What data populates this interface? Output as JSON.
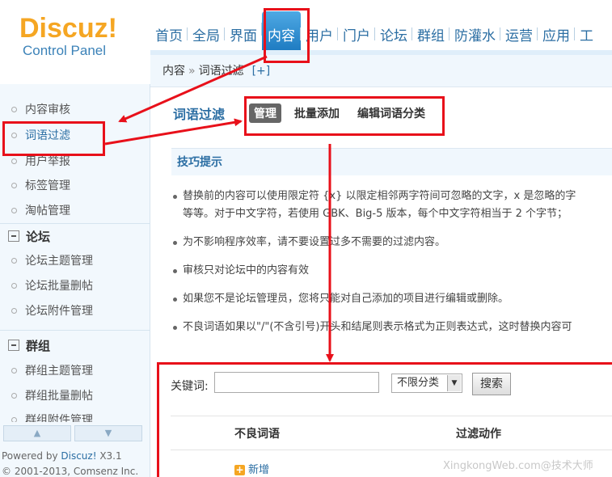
{
  "logo": {
    "main": "Discuz!",
    "sub": "Control Panel"
  },
  "topnav": [
    "首页",
    "全局",
    "界面",
    "内容",
    "用户",
    "门户",
    "论坛",
    "群组",
    "防灌水",
    "运营",
    "应用",
    "工"
  ],
  "breadcrumb": {
    "parent": "内容",
    "sep": "»",
    "current": "词语过滤",
    "expand": "[+]"
  },
  "sidebar": {
    "items": [
      "内容审核",
      "词语过滤",
      "用户举报",
      "标签管理",
      "淘帖管理"
    ],
    "forum_group": "论坛",
    "forum_items": [
      "论坛主题管理",
      "论坛批量删帖",
      "论坛附件管理"
    ],
    "group_group": "群组",
    "group_items": [
      "群组主题管理",
      "群组批量删帖",
      "群组附件管理"
    ],
    "scroll_up": "▲",
    "scroll_down": "▼",
    "powered_prefix": "Powered by ",
    "powered_brand": "Discuz!",
    "powered_version": " X3.1",
    "copyright": "© 2001-2013, Comsenz Inc."
  },
  "main": {
    "title": "词语过滤",
    "subtabs": [
      "管理",
      "批量添加",
      "编辑词语分类"
    ],
    "tips_title": "技巧提示",
    "tips": [
      "替换前的内容可以使用限定符 {x} 以限定相邻两字符间可忽略的文字，x 是忽略的字",
      "等等。对于中文字符，若使用 GBK、Big-5 版本，每个中文字符相当于 2 个字节；",
      "为不影响程序效率，请不要设置过多不需要的过滤内容。",
      "审核只对论坛中的内容有效",
      "如果您不是论坛管理员，您将只能对自己添加的项目进行编辑或删除。",
      "不良词语如果以\"/\"(不含引号)开头和结尾则表示格式为正则表达式，这时替换内容可"
    ]
  },
  "search": {
    "label": "关键词:",
    "input_value": "",
    "select_value": "不限分类",
    "select_arrow": "▼",
    "button": "搜索",
    "col_word": "不良词语",
    "col_action": "过滤动作",
    "add_icon": "+",
    "add_label": "新增"
  },
  "watermark": "XingkongWeb.com@技术大师",
  "colors": {
    "accent": "#2b6ea3",
    "logo": "#f5a623",
    "annotation": "#e8101a"
  }
}
